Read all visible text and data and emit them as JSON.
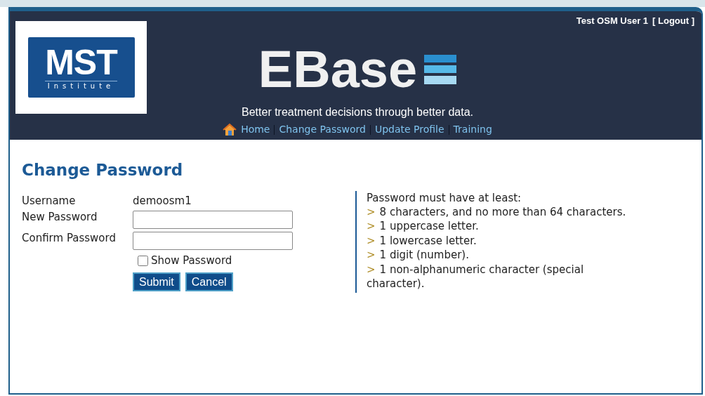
{
  "header": {
    "user": "Test OSM User 1",
    "logout": "[ Logout ]",
    "logo": {
      "title": "MST",
      "subtitle": "Institute"
    },
    "brand": "EBase",
    "tagline": "Better treatment decisions through better data.",
    "nav": [
      {
        "label": "Home",
        "kind": "home"
      },
      {
        "label": "Change Password",
        "kind": "link"
      },
      {
        "label": "Update Profile",
        "kind": "link"
      },
      {
        "label": "Training",
        "kind": "link"
      }
    ]
  },
  "page": {
    "title": "Change Password",
    "username": {
      "label": "Username",
      "value": "demoosm1"
    },
    "fields": [
      {
        "label": "New Password"
      },
      {
        "label": "Confirm Password"
      }
    ],
    "show_password": {
      "label": "Show Password",
      "checked": false
    },
    "buttons": [
      "Submit",
      "Cancel"
    ],
    "rules": {
      "heading": "Password must have at least:",
      "items": [
        {
          "marker": ">",
          "text": "8 characters, and no more than 64 characters."
        },
        {
          "marker": ">",
          "text": "1 uppercase letter."
        },
        {
          "marker": ">",
          "text": "1 lowercase letter."
        },
        {
          "marker": ">",
          "text": "1 digit (number)."
        },
        {
          "marker": ">",
          "text": "1 non-alphanumeric character (special character)."
        }
      ]
    }
  }
}
